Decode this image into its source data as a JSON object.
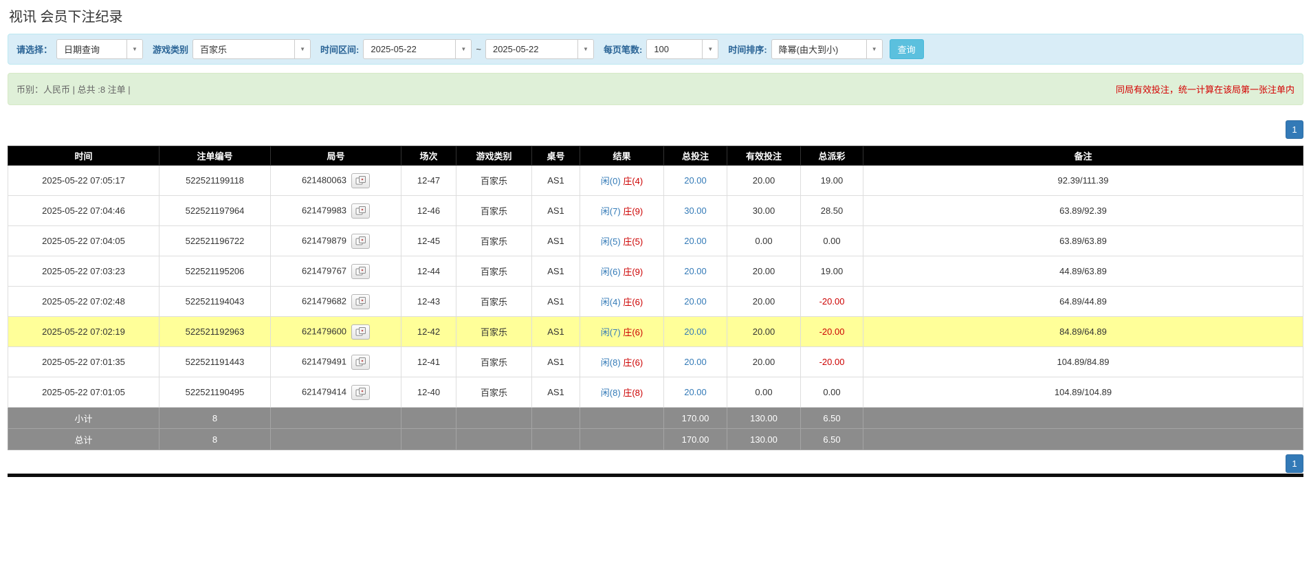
{
  "page": {
    "title": "视讯 会员下注纪录"
  },
  "filters": {
    "select_label": "请选择：",
    "select_value": "日期查询",
    "game_type_label": "游戏类别",
    "game_type_value": "百家乐",
    "time_range_label": "时间区间:",
    "date_from": "2025-05-22",
    "range_separator": "~",
    "date_to": "2025-05-22",
    "page_size_label": "每页笔数:",
    "page_size_value": "100",
    "sort_label": "时间排序:",
    "sort_value": "降幂(由大到小)",
    "search_button": "查询"
  },
  "summary": {
    "left": "币别：人民币 | 总共 :8 注单 |",
    "right": "同局有效投注，统一计算在该局第一张注单内"
  },
  "pagination": {
    "page": "1"
  },
  "colors": {
    "accent_blue": "#337ab7",
    "result_player_blue": "#337ab7",
    "result_banker_red": "#cc0000",
    "negative_red": "#cc0000",
    "highlight_yellow": "#ffff99",
    "header_black": "#000000",
    "footer_gray": "#8c8c8c",
    "filter_bar_blue": "#d9edf7",
    "summary_bar_green": "#dff0d8",
    "notice_red": "#d40000"
  },
  "table": {
    "headers": [
      "时间",
      "注单编号",
      "局号",
      "场次",
      "游戏类别",
      "桌号",
      "结果",
      "总投注",
      "有效投注",
      "总派彩",
      "备注"
    ],
    "rows": [
      {
        "time": "2025-05-22 07:05:17",
        "bet_id": "522521199118",
        "round": "621480063",
        "session": "12-47",
        "game": "百家乐",
        "table_no": "AS1",
        "result_player": "闲(0)",
        "result_banker": "庄(4)",
        "total_bet": "20.00",
        "valid_bet": "20.00",
        "payout": "19.00",
        "note": "92.39/111.39",
        "highlight": false
      },
      {
        "time": "2025-05-22 07:04:46",
        "bet_id": "522521197964",
        "round": "621479983",
        "session": "12-46",
        "game": "百家乐",
        "table_no": "AS1",
        "result_player": "闲(7)",
        "result_banker": "庄(9)",
        "total_bet": "30.00",
        "valid_bet": "30.00",
        "payout": "28.50",
        "note": "63.89/92.39",
        "highlight": false
      },
      {
        "time": "2025-05-22 07:04:05",
        "bet_id": "522521196722",
        "round": "621479879",
        "session": "12-45",
        "game": "百家乐",
        "table_no": "AS1",
        "result_player": "闲(5)",
        "result_banker": "庄(5)",
        "total_bet": "20.00",
        "valid_bet": "0.00",
        "payout": "0.00",
        "note": "63.89/63.89",
        "highlight": false
      },
      {
        "time": "2025-05-22 07:03:23",
        "bet_id": "522521195206",
        "round": "621479767",
        "session": "12-44",
        "game": "百家乐",
        "table_no": "AS1",
        "result_player": "闲(6)",
        "result_banker": "庄(9)",
        "total_bet": "20.00",
        "valid_bet": "20.00",
        "payout": "19.00",
        "note": "44.89/63.89",
        "highlight": false
      },
      {
        "time": "2025-05-22 07:02:48",
        "bet_id": "522521194043",
        "round": "621479682",
        "session": "12-43",
        "game": "百家乐",
        "table_no": "AS1",
        "result_player": "闲(4)",
        "result_banker": "庄(6)",
        "total_bet": "20.00",
        "valid_bet": "20.00",
        "payout": "-20.00",
        "note": "64.89/44.89",
        "highlight": false
      },
      {
        "time": "2025-05-22 07:02:19",
        "bet_id": "522521192963",
        "round": "621479600",
        "session": "12-42",
        "game": "百家乐",
        "table_no": "AS1",
        "result_player": "闲(7)",
        "result_banker": "庄(6)",
        "total_bet": "20.00",
        "valid_bet": "20.00",
        "payout": "-20.00",
        "note": "84.89/64.89",
        "highlight": true
      },
      {
        "time": "2025-05-22 07:01:35",
        "bet_id": "522521191443",
        "round": "621479491",
        "session": "12-41",
        "game": "百家乐",
        "table_no": "AS1",
        "result_player": "闲(8)",
        "result_banker": "庄(6)",
        "total_bet": "20.00",
        "valid_bet": "20.00",
        "payout": "-20.00",
        "note": "104.89/84.89",
        "highlight": false
      },
      {
        "time": "2025-05-22 07:01:05",
        "bet_id": "522521190495",
        "round": "621479414",
        "session": "12-40",
        "game": "百家乐",
        "table_no": "AS1",
        "result_player": "闲(8)",
        "result_banker": "庄(8)",
        "total_bet": "20.00",
        "valid_bet": "0.00",
        "payout": "0.00",
        "note": "104.89/104.89",
        "highlight": false
      }
    ],
    "footer_rows": [
      {
        "label": "小计",
        "count": "8",
        "total_bet": "170.00",
        "valid_bet": "130.00",
        "payout": "6.50"
      },
      {
        "label": "总计",
        "count": "8",
        "total_bet": "170.00",
        "valid_bet": "130.00",
        "payout": "6.50"
      }
    ]
  }
}
